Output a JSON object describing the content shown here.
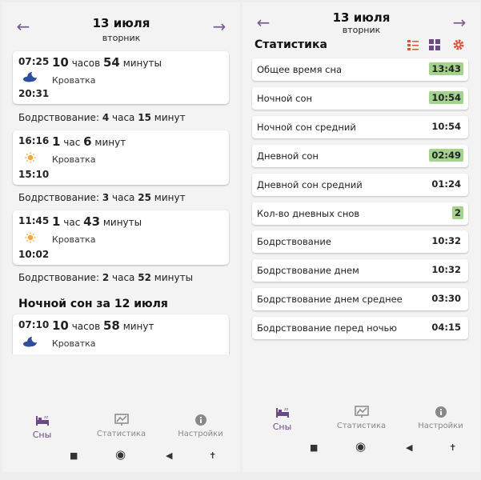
{
  "left": {
    "header": {
      "date": "13 июля",
      "weekday": "вторник"
    },
    "cards": [
      {
        "start": "07:25",
        "end": "20:31",
        "icon": "moon-cloud-icon",
        "h": "10",
        "hw": "часов",
        "m": "54",
        "mw": "минуты",
        "place": "Кроватка"
      },
      {
        "start": "16:16",
        "end": "15:10",
        "icon": "sun-icon",
        "h": "1",
        "hw": "час",
        "m": "6",
        "mw": "минут",
        "place": "Кроватка"
      },
      {
        "start": "11:45",
        "end": "10:02",
        "icon": "sun-icon",
        "h": "1",
        "hw": "час",
        "m": "43",
        "mw": "минуты",
        "place": "Кроватка"
      },
      {
        "start": "07:10",
        "end": "",
        "icon": "moon-cloud-icon",
        "h": "10",
        "hw": "часов",
        "m": "58",
        "mw": "минут",
        "place": "Кроватка"
      }
    ],
    "awake": [
      {
        "label": "Бодрствование:",
        "h": "4",
        "hw": "часа",
        "m": "15",
        "mw": "минут"
      },
      {
        "label": "Бодрствование:",
        "h": "3",
        "hw": "часа",
        "m": "25",
        "mw": "минут"
      },
      {
        "label": "Бодрствование:",
        "h": "2",
        "hw": "часа",
        "m": "52",
        "mw": "минуты"
      }
    ],
    "section_title": "Ночной сон за 12 июля"
  },
  "right": {
    "header": {
      "date": "13 июля",
      "weekday": "вторник"
    },
    "title": "Статистика",
    "rows": [
      {
        "label": "Общее время сна",
        "value": "13:43",
        "highlight": true
      },
      {
        "label": "Ночной сон",
        "value": "10:54",
        "highlight": true
      },
      {
        "label": "Ночной сон средний",
        "value": "10:54",
        "highlight": false
      },
      {
        "label": "Дневной сон",
        "value": "02:49",
        "highlight": true
      },
      {
        "label": "Дневной сон средний",
        "value": "01:24",
        "highlight": false
      },
      {
        "label": "Кол-во дневных снов",
        "value": "2",
        "highlight": true
      },
      {
        "label": "Бодрствование",
        "value": "10:32",
        "highlight": false
      },
      {
        "label": "Бодрствование днем",
        "value": "10:32",
        "highlight": false
      },
      {
        "label": "Бодрствование днем среднее",
        "value": "03:30",
        "highlight": false
      },
      {
        "label": "Бодрствование перед ночью",
        "value": "04:15",
        "highlight": false
      }
    ]
  },
  "nav": {
    "sleeps": "Сны",
    "stats": "Статистика",
    "settings": "Настройки"
  },
  "colors": {
    "accent": "#6a4a86",
    "highlight": "#a4d38e",
    "moon": "#2f4d9a",
    "sun": "#f2a93b",
    "gear": "#e0523a"
  }
}
